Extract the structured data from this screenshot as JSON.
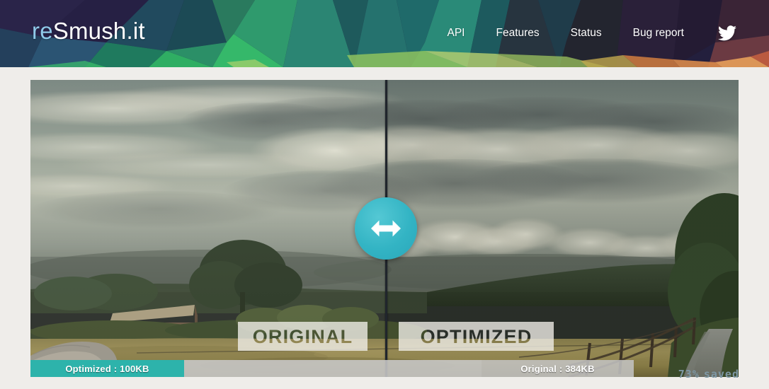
{
  "header": {
    "logo": {
      "prefix": "re",
      "suffix": "Smush.it",
      "accent_color": "#8fc9e8"
    },
    "nav": [
      {
        "label": "API",
        "name": "nav-link-api"
      },
      {
        "label": "Features",
        "name": "nav-link-features"
      },
      {
        "label": "Status",
        "name": "nav-link-status"
      },
      {
        "label": "Bug report",
        "name": "nav-link-bug-report"
      }
    ],
    "social": {
      "icon": "twitter-icon",
      "label": "Twitter"
    },
    "background": {
      "style": "low-poly-triangles",
      "colors": [
        "#231f3d",
        "#2b2550",
        "#1e3a4f",
        "#1f5f63",
        "#2f8f6b",
        "#3cc06a",
        "#4fc97a",
        "#2c2a4a",
        "#3a2038",
        "#6b3a3f",
        "#c8703f",
        "#e8a05a",
        "#b9cf6e",
        "#8fbf5e"
      ]
    }
  },
  "compare": {
    "image_alt": "Countryside field with dramatic cloudy sky, barn, trees and wooden fence",
    "divider_color": "#20252c",
    "handle": {
      "icon": "horizontal-resize-arrows-icon",
      "color": "#33b4c4"
    },
    "label_left": "ORIGINAL",
    "label_right": "OPTIMIZED",
    "bar_optimized": "Optimized : 100KB",
    "bar_original": "Original : 384KB",
    "bar_optimized_color": "#2db3ab",
    "bar_original_color": "#c4c4c4",
    "saved_percent": "73%",
    "saved_label": "saved",
    "saved_color": "#7d97a4"
  }
}
